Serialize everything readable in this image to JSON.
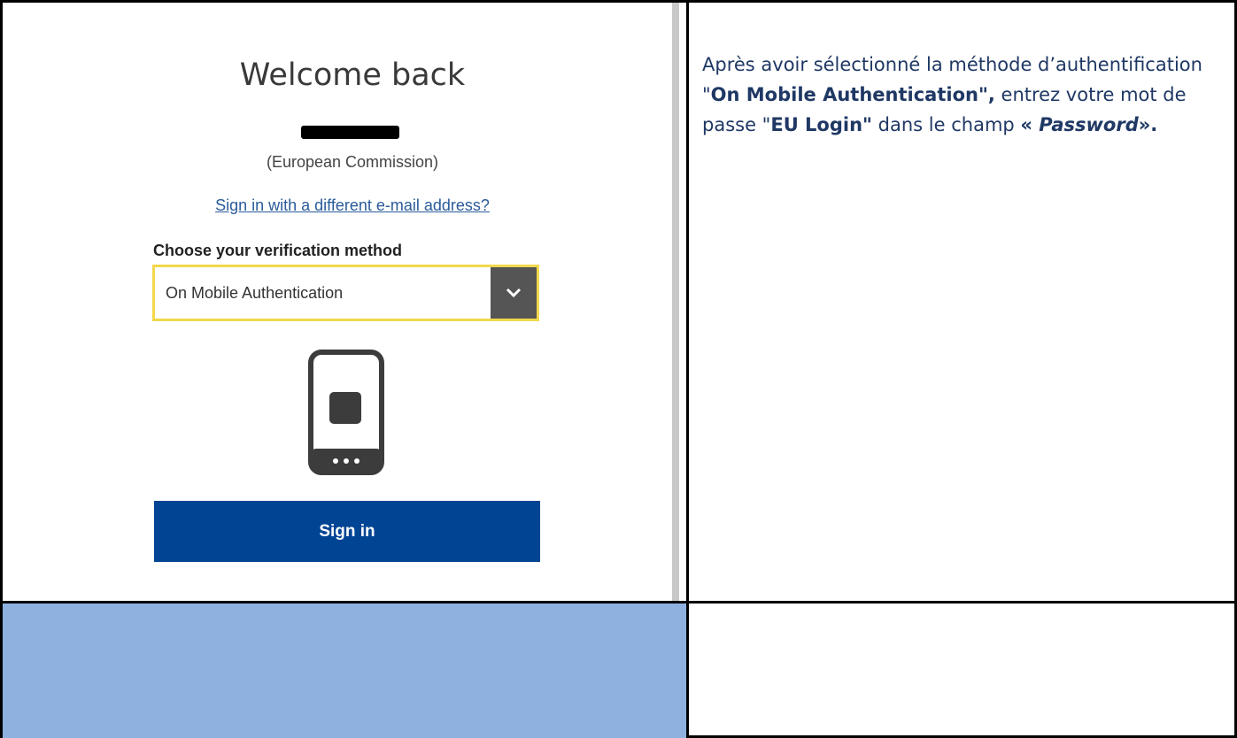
{
  "screenshot": {
    "title": "Welcome back",
    "organization": "(European Commission)",
    "alt_login_link": "Sign in with a different e-mail address?",
    "verification_label": "Choose your verification method",
    "verification_method": "On Mobile Authentication",
    "signin_label": "Sign in",
    "icons": [
      "chevron-down-icon",
      "mobile-phone-icon"
    ]
  },
  "instruction": {
    "part1": "Après avoir sélectionné la méthode d’authentification \"",
    "method_bold": "On Mobile Authentication\",",
    "part2": " entrez votre mot de passe \"",
    "login_bold": "EU Login\"",
    "part3": " dans le champ ",
    "field_open": "« ",
    "field_name": "Password",
    "field_close": "»."
  },
  "colors": {
    "instruction_text": "#1f3864",
    "signin_button": "#004494",
    "select_border": "#f2d84c",
    "empty_cell": "#8eb1e0"
  }
}
